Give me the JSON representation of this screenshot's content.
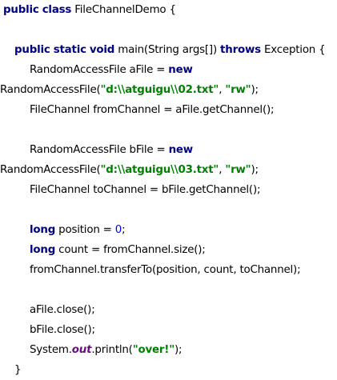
{
  "code": {
    "l1": {
      "kw1": "public",
      "kw2": "class",
      "rest": " FileChannelDemo {"
    },
    "l2": {
      "kw1": "public",
      "kw2": "static",
      "kw3": "void",
      "mid": " main(String args[]) ",
      "kw4": "throws",
      "rest": " Exception {"
    },
    "l3": {
      "text": "RandomAccessFile aFile = ",
      "kw": "new"
    },
    "l4": {
      "pre": "RandomAccessFile(",
      "str1": "\"d:\\\\atguigu\\\\02.txt\"",
      "mid": ", ",
      "str2": "\"rw\"",
      "rest": ");"
    },
    "l5": {
      "text": "FileChannel fromChannel = aFile.getChannel();"
    },
    "l6": {
      "text": "RandomAccessFile bFile = ",
      "kw": "new"
    },
    "l7": {
      "pre": "RandomAccessFile(",
      "str1": "\"d:\\\\atguigu\\\\03.txt\"",
      "mid": ", ",
      "str2": "\"rw\"",
      "rest": ");"
    },
    "l8": {
      "text": "FileChannel toChannel = bFile.getChannel();"
    },
    "l9": {
      "kw": "long",
      "mid": " position = ",
      "num": "0",
      "rest": ";"
    },
    "l10": {
      "kw": "long",
      "rest": " count = fromChannel.size();"
    },
    "l11": {
      "text": "fromChannel.transferTo(position, count, toChannel);"
    },
    "l12": {
      "text": "aFile.close();"
    },
    "l13": {
      "text": "bFile.close();"
    },
    "l14": {
      "pre": "System.",
      "field": "out",
      "mid": ".println(",
      "str": "\"over!\"",
      "rest": ");"
    },
    "l15": {
      "text": "}"
    }
  },
  "colors": {
    "keyword": "#000080",
    "string": "#008000",
    "static_field": "#660e7a",
    "number": "#0000ff"
  }
}
